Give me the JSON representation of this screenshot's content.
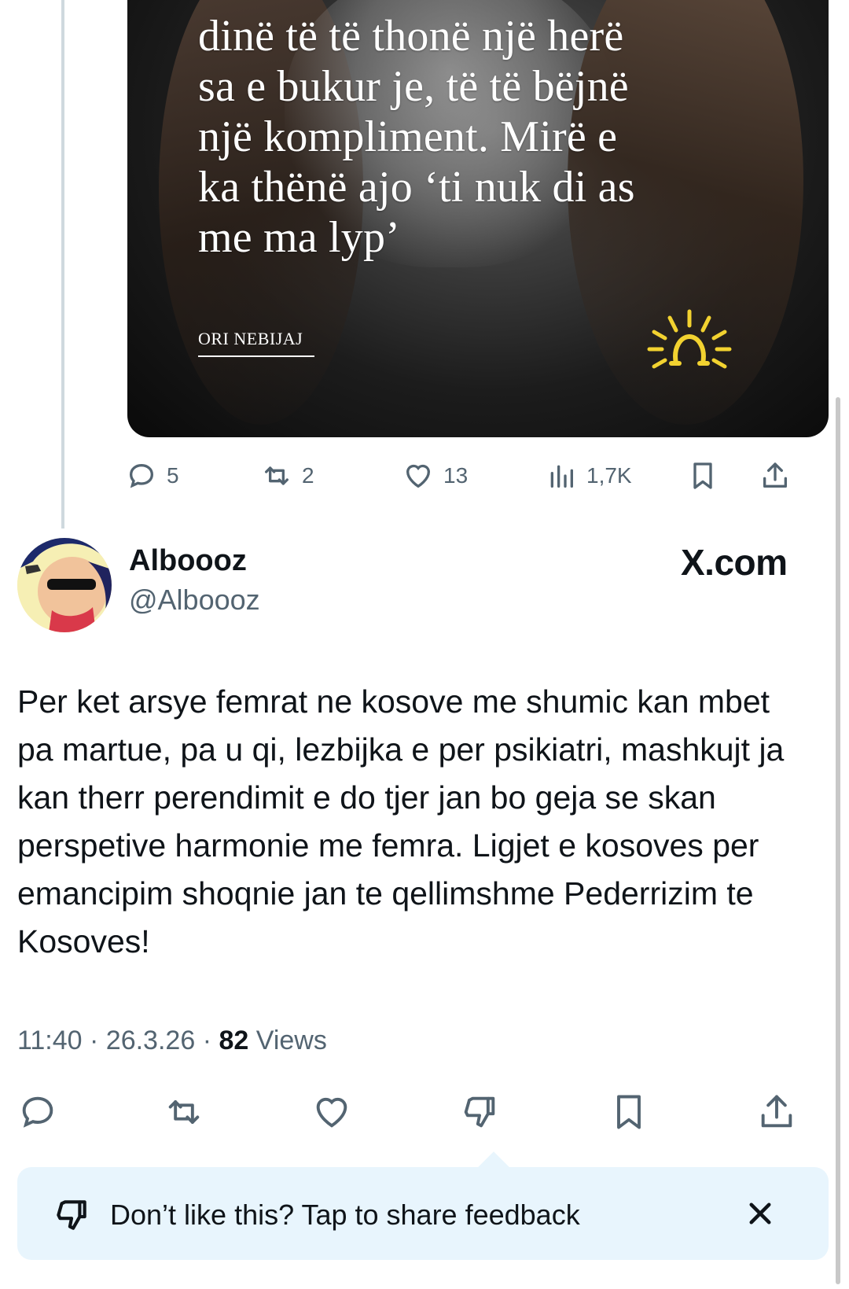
{
  "quoted_post": {
    "image_quote_lines": [
      "dinë të të thonë një herë",
      "sa e bukur je, të të bëjnë",
      "një kompliment. Mirë e",
      "ka thënë ajo ‘ti nuk di as",
      "me ma lyp’"
    ],
    "image_byline": "ORI NEBIJAJ",
    "image_logo_icon": "sun-logo-icon",
    "stats": {
      "replies": "5",
      "reposts": "2",
      "likes": "13",
      "views": "1,7K"
    }
  },
  "post": {
    "display_name": "Alboooz",
    "handle": "@Alboooz",
    "watermark": "X.com",
    "text": "Per ket arsye femrat ne kosove me shumic kan mbet pa martue, pa u qi, lezbijka e per psikiatri, mashkujt ja kan therr perendimit e do tjer jan bo geja se skan perspetive harmonie me femra. Ligjet e kosoves per emancipim shoqnie jan te qellimshme Pederrizim te Kosoves!",
    "time": "11:40",
    "date": "26.3.26",
    "separator": "·",
    "views_count": "82",
    "views_label": "Views"
  },
  "feedback_banner": {
    "text": "Don’t like this? Tap to share feedback"
  },
  "colors": {
    "text_primary": "#0f1419",
    "text_secondary": "#536471",
    "banner_bg": "#e8f5fd",
    "logo_yellow": "#f2d230"
  }
}
